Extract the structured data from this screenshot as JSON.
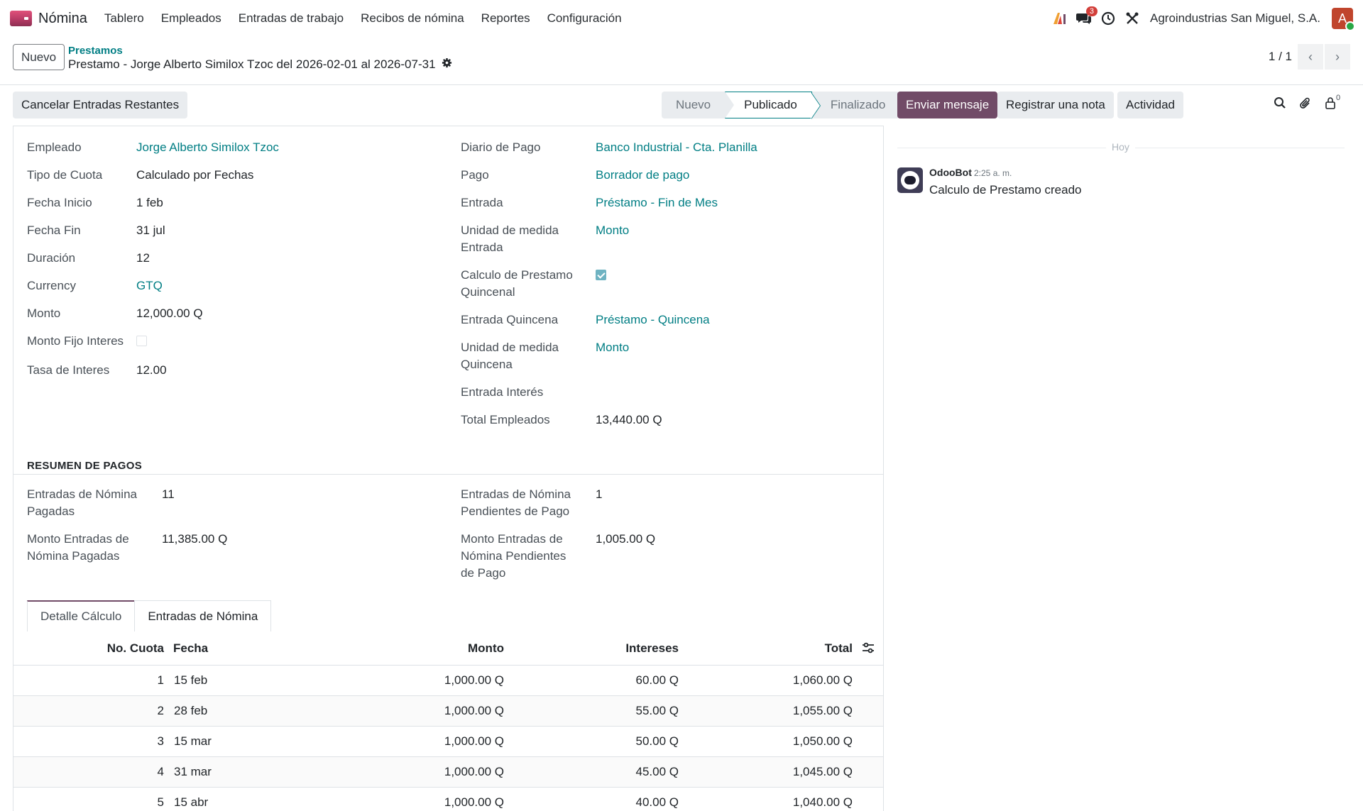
{
  "navbar": {
    "app_name": "Nómina",
    "menu": [
      "Tablero",
      "Empleados",
      "Entradas de trabajo",
      "Recibos de nómina",
      "Reportes",
      "Configuración"
    ],
    "messages_badge": "3",
    "company": "Agroindustrias San Miguel, S.A.",
    "avatar_letter": "A"
  },
  "control": {
    "new_button": "Nuevo",
    "breadcrumb_parent": "Prestamos",
    "record_title": "Prestamo - Jorge Alberto Similox Tzoc del 2026-02-01 al 2026-07-31",
    "pager": "1 / 1"
  },
  "actions": {
    "cancel_entries": "Cancelar Entradas Restantes",
    "stages": [
      "Nuevo",
      "Publicado",
      "Finalizado"
    ],
    "active_stage": "Publicado"
  },
  "chatter": {
    "send_message": "Enviar mensaje",
    "log_note": "Registrar una nota",
    "activity": "Actividad",
    "followers_count": "0",
    "today": "Hoy",
    "author": "OdooBot",
    "time": "2:25 a. m.",
    "message": "Calculo de Prestamo creado"
  },
  "form": {
    "left": [
      {
        "label": "Empleado",
        "value": "Jorge Alberto Similox Tzoc",
        "link": true
      },
      {
        "label": "Tipo de Cuota",
        "value": "Calculado por Fechas"
      },
      {
        "label": "Fecha Inicio",
        "value": "1 feb"
      },
      {
        "label": "Fecha Fin",
        "value": "31 jul"
      },
      {
        "label": "Duración",
        "value": "12"
      },
      {
        "label": "Currency",
        "value": "GTQ",
        "link": true
      },
      {
        "label": "Monto",
        "value": "12,000.00 Q"
      },
      {
        "label": "Monto Fijo Interes",
        "checkbox": false
      },
      {
        "label": "Tasa de Interes",
        "value": "12.00"
      }
    ],
    "right": [
      {
        "label": "Diario de Pago",
        "value": "Banco Industrial - Cta. Planilla",
        "link": true
      },
      {
        "label": "Pago",
        "value": "Borrador de pago",
        "link": true
      },
      {
        "label": "Entrada",
        "value": "Préstamo - Fin de Mes",
        "link": true
      },
      {
        "label": "Unidad de medida Entrada",
        "value": "Monto",
        "link": true
      },
      {
        "label": "Calculo de Prestamo Quincenal",
        "checkbox": true
      },
      {
        "label": "Entrada Quincena",
        "value": "Préstamo - Quincena",
        "link": true
      },
      {
        "label": "Unidad de medida Quincena",
        "value": "Monto",
        "link": true
      },
      {
        "label": "Entrada Interés",
        "value": ""
      },
      {
        "label": "Total Empleados",
        "value": "13,440.00 Q"
      }
    ]
  },
  "summary": {
    "title": "RESUMEN DE PAGOS",
    "paid_count_label": "Entradas de Nómina Pagadas",
    "paid_count": "11",
    "pending_count_label": "Entradas de Nómina Pendientes de Pago",
    "pending_count": "1",
    "paid_amount_label": "Monto Entradas de Nómina Pagadas",
    "paid_amount": "11,385.00 Q",
    "pending_amount_label": "Monto Entradas de Nómina Pendientes de Pago",
    "pending_amount": "1,005.00 Q"
  },
  "tabs": [
    "Detalle Cálculo",
    "Entradas de Nómina"
  ],
  "table": {
    "headers": [
      "No. Cuota",
      "Fecha",
      "Monto",
      "Intereses",
      "Total"
    ],
    "rows": [
      [
        "1",
        "15 feb",
        "1,000.00 Q",
        "60.00 Q",
        "1,060.00 Q"
      ],
      [
        "2",
        "28 feb",
        "1,000.00 Q",
        "55.00 Q",
        "1,055.00 Q"
      ],
      [
        "3",
        "15 mar",
        "1,000.00 Q",
        "50.00 Q",
        "1,050.00 Q"
      ],
      [
        "4",
        "31 mar",
        "1,000.00 Q",
        "45.00 Q",
        "1,045.00 Q"
      ],
      [
        "5",
        "15 abr",
        "1,000.00 Q",
        "40.00 Q",
        "1,040.00 Q"
      ]
    ]
  }
}
